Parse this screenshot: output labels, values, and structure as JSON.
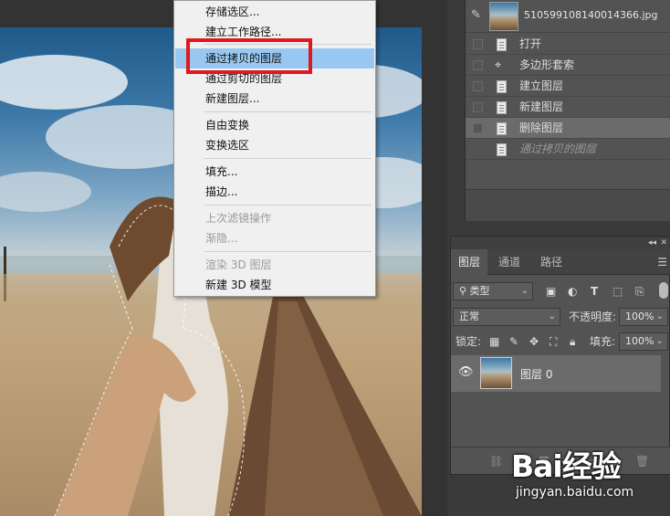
{
  "context_menu": {
    "items": [
      {
        "label": "存储选区...",
        "disabled": false
      },
      {
        "label": "建立工作路径...",
        "disabled": false
      },
      {
        "label": "通过拷贝的图层",
        "disabled": false,
        "highlighted": true
      },
      {
        "label": "通过剪切的图层",
        "disabled": false
      },
      {
        "label": "新建图层...",
        "disabled": false
      },
      {
        "label": "自由变换",
        "disabled": false
      },
      {
        "label": "变换选区",
        "disabled": false
      },
      {
        "label": "填充...",
        "disabled": false
      },
      {
        "label": "描边...",
        "disabled": false
      },
      {
        "label": "上次滤镜操作",
        "disabled": true
      },
      {
        "label": "渐隐...",
        "disabled": true
      },
      {
        "label": "渲染 3D 图层",
        "disabled": true
      },
      {
        "label": "新建 3D 模型",
        "disabled": false
      }
    ]
  },
  "history": {
    "snapshot_name": "510599108140014366.jpg",
    "steps": [
      {
        "label": "打开",
        "icon": "document-icon"
      },
      {
        "label": "多边形套索",
        "icon": "polygonal-lasso-icon"
      },
      {
        "label": "建立图层",
        "icon": "document-icon"
      },
      {
        "label": "新建图层",
        "icon": "document-icon"
      },
      {
        "label": "删除图层",
        "icon": "document-icon",
        "active": true
      },
      {
        "label": "通过拷贝的图层",
        "icon": "document-icon",
        "future": true
      }
    ]
  },
  "layers": {
    "tabs": [
      "图层",
      "通道",
      "路径"
    ],
    "filter_kind": "类型",
    "blend_mode": "正常",
    "opacity_label": "不透明度:",
    "opacity_value": "100%",
    "lock_label": "锁定:",
    "fill_label": "填充:",
    "fill_value": "100%",
    "layer_name": "图层 0"
  },
  "watermark": {
    "logo": "Bai经验",
    "url": "jingyan.baidu.com"
  },
  "colors": {
    "menu_highlight": "#98c8f2",
    "annotation_red": "#e0181e",
    "panel_bg": "#535353"
  }
}
